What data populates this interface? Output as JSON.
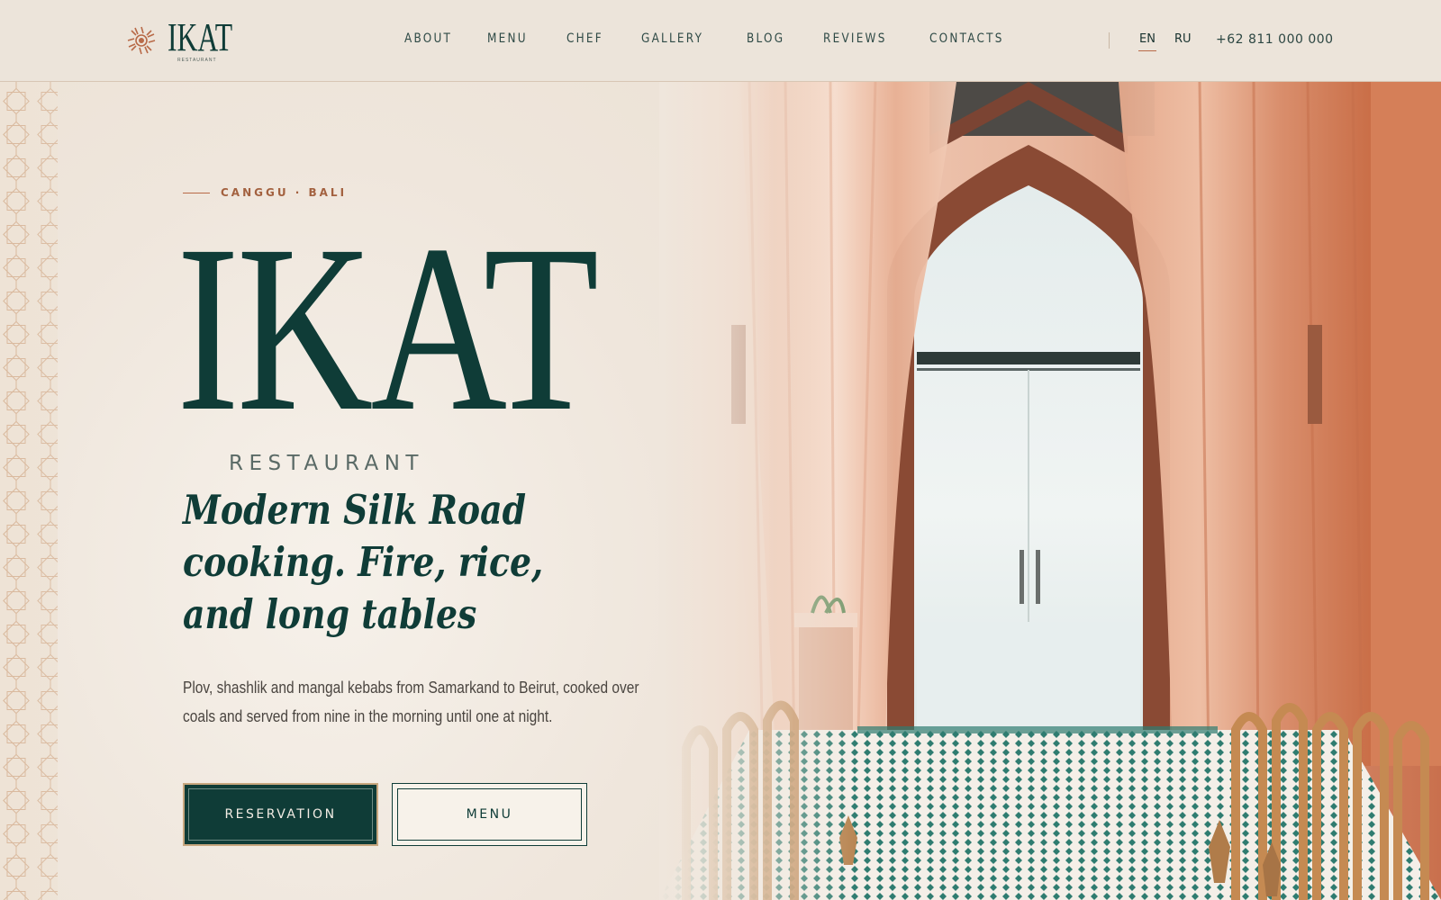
{
  "header": {
    "logo": {
      "word": "IKAT",
      "sub": "RESTAURANT"
    },
    "nav": [
      "ABOUT",
      "MENU",
      "CHEF",
      "GALLERY",
      "BLOG",
      "REVIEWS",
      "CONTACTS"
    ],
    "languages": {
      "en": "EN",
      "ru": "RU",
      "active": "EN"
    },
    "phone": "+62 811 000 000"
  },
  "hero": {
    "eyebrow": "CANGGU · BALI",
    "title": "IKAT",
    "subtitle": "RESTAURANT",
    "tagline": [
      "Modern Silk Road",
      "cooking. Fire, rice,",
      "and long tables"
    ],
    "description": [
      "Plov, shashlik and mangal kebabs from Samarkand to Beirut, cooked over",
      "coals and served from nine in the morning until one at night."
    ],
    "buttons": {
      "reservation": "RESERVATION",
      "menu": "MENU"
    }
  },
  "colors": {
    "brand": "#0f3c37",
    "accent": "#b86a48",
    "background": "#efe6dc"
  },
  "icons": [
    "sun-logo-icon",
    "star-lattice-pattern"
  ]
}
